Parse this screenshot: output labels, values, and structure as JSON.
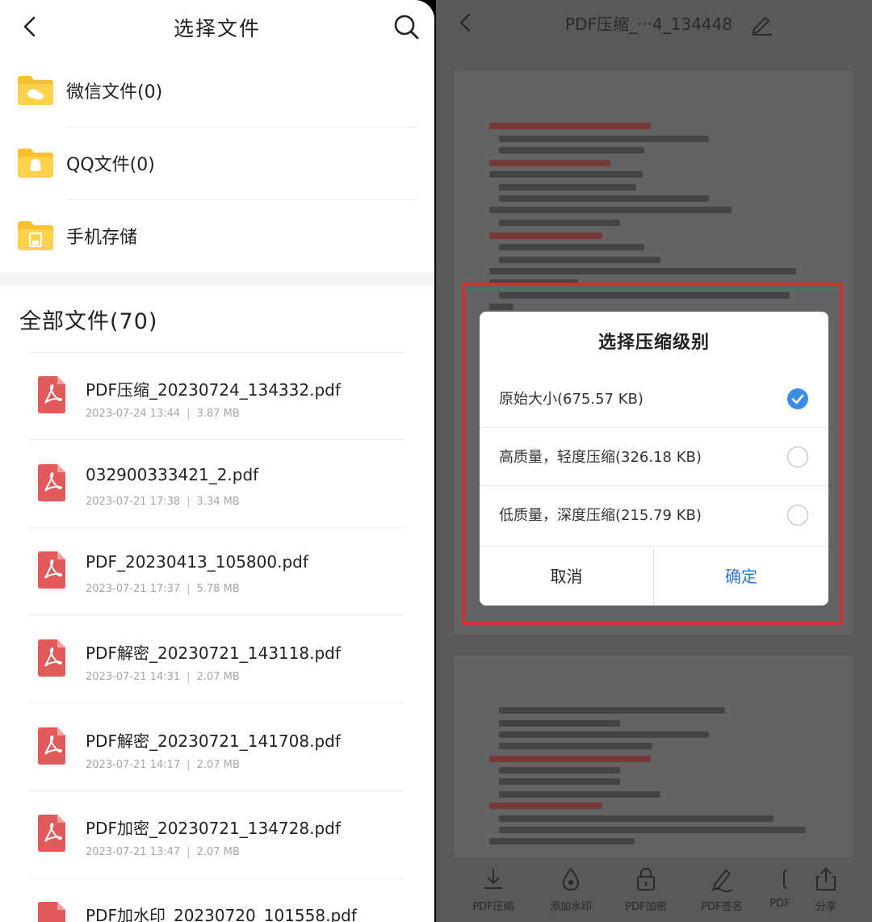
{
  "left": {
    "title": "选择文件",
    "folders": [
      {
        "label": "微信文件(0)",
        "icon": "wechat-folder-icon"
      },
      {
        "label": "QQ文件(0)",
        "icon": "qq-folder-icon"
      },
      {
        "label": "手机存储",
        "icon": "phone-storage-folder-icon"
      }
    ],
    "all_files_title": "全部文件(70)",
    "files": [
      {
        "name": "PDF压缩_20230724_134332.pdf",
        "date": "2023-07-24 13:44",
        "size": "3.87 MB"
      },
      {
        "name": "032900333421_2.pdf",
        "date": "2023-07-21 17:38",
        "size": "3.34 MB"
      },
      {
        "name": "PDF_20230413_105800.pdf",
        "date": "2023-07-21 17:37",
        "size": "5.78 MB"
      },
      {
        "name": "PDF解密_20230721_143118.pdf",
        "date": "2023-07-21 14:31",
        "size": "2.07 MB"
      },
      {
        "name": "PDF解密_20230721_141708.pdf",
        "date": "2023-07-21 14:17",
        "size": "2.07 MB"
      },
      {
        "name": "PDF加密_20230721_134728.pdf",
        "date": "2023-07-21 13:47",
        "size": "2.07 MB"
      },
      {
        "name": "PDF加水印_20230720_101558.pdf",
        "date": "",
        "size": ""
      }
    ],
    "meta_separator": "|"
  },
  "right": {
    "title": "PDF压缩_···4_134448",
    "dialog": {
      "title": "选择压缩级别",
      "options": [
        {
          "label": "原始大小(675.57 KB)",
          "selected": true
        },
        {
          "label": "高质量，轻度压缩(326.18 KB)",
          "selected": false
        },
        {
          "label": "低质量，深度压缩(215.79 KB)",
          "selected": false
        }
      ],
      "cancel_label": "取消",
      "ok_label": "确定"
    },
    "toolbar": [
      {
        "label": "PDF压缩",
        "icon": "download-compress-icon"
      },
      {
        "label": "添加水印",
        "icon": "watermark-drop-icon"
      },
      {
        "label": "PDF加密",
        "icon": "lock-icon"
      },
      {
        "label": "PDF签名",
        "icon": "pen-signature-icon"
      },
      {
        "label": "PDF",
        "icon": "pdf-tool-icon"
      },
      {
        "label": "分享",
        "icon": "share-icon"
      }
    ]
  },
  "colors": {
    "accent_blue": "#2b7bd1",
    "radio_selected": "#3a8ee6",
    "folder_yellow": "#f7c12e",
    "pdf_red": "#e25b5b",
    "highlight_red": "#d42f2c",
    "overlay_gray": "#595959"
  }
}
